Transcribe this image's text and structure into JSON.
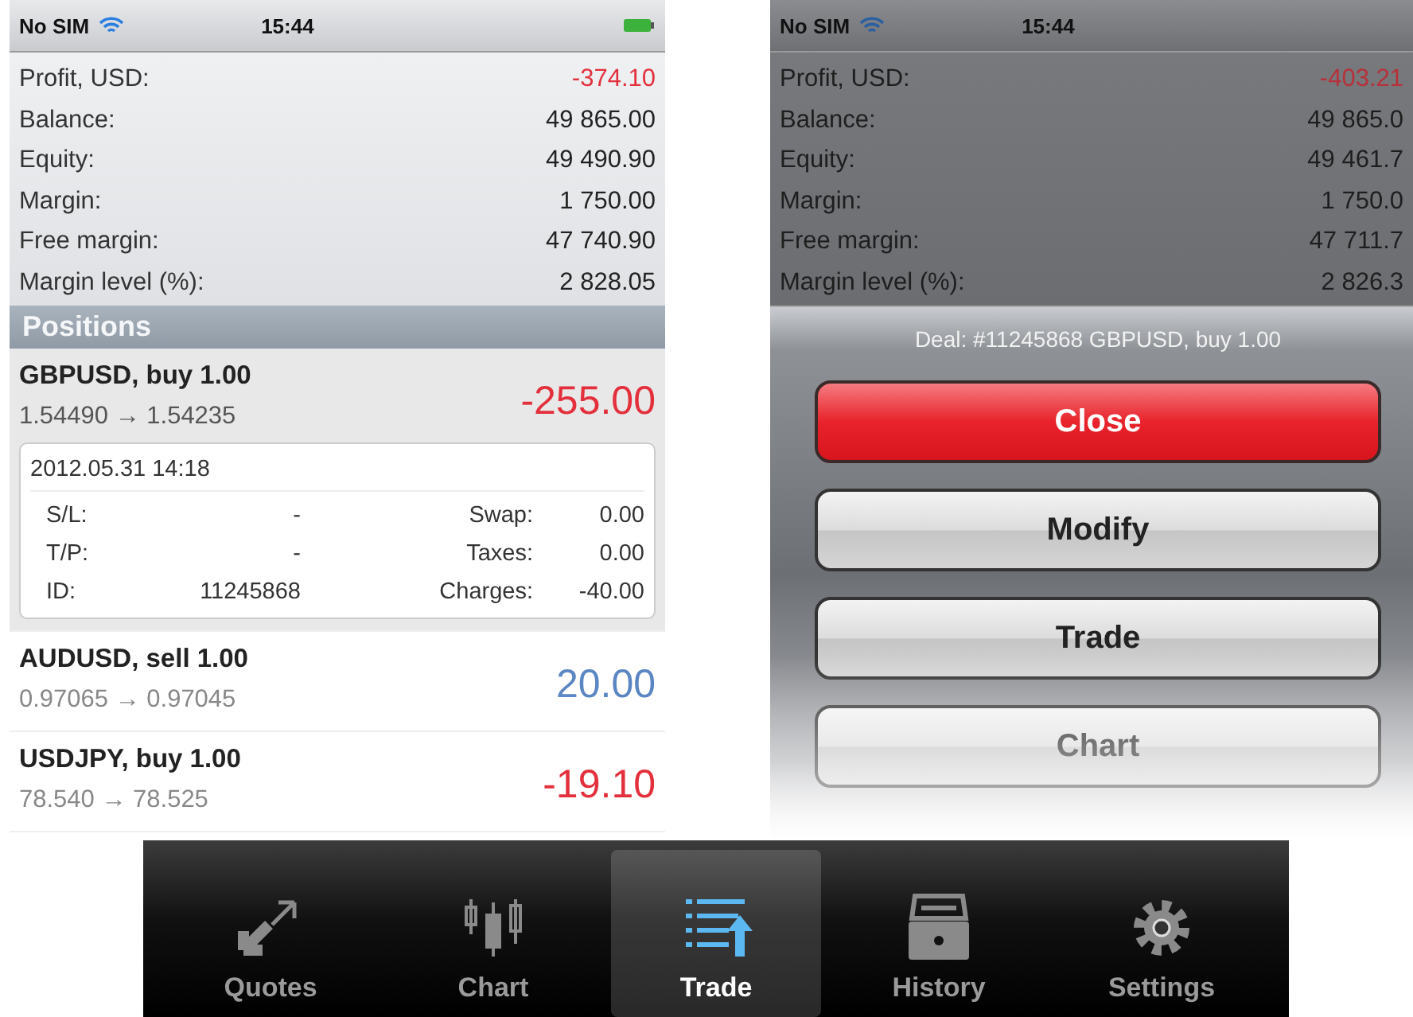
{
  "left_screen": {
    "status_bar": {
      "carrier": "No SIM",
      "time": "15:44"
    },
    "summary": [
      {
        "label": "Profit, USD:",
        "value": "-374.10",
        "color": "#e3303c"
      },
      {
        "label": "Balance:",
        "value": "49 865.00",
        "color": "#222222"
      },
      {
        "label": "Equity:",
        "value": "49 490.90",
        "color": "#222222"
      },
      {
        "label": "Margin:",
        "value": "1 750.00",
        "color": "#222222"
      },
      {
        "label": "Free margin:",
        "value": "47 740.90",
        "color": "#222222"
      },
      {
        "label": "Margin level (%):",
        "value": "2 828.05",
        "color": "#222222"
      }
    ],
    "section_title": "Positions",
    "positions": [
      {
        "title": "GBPUSD, buy 1.00",
        "prices": "1.54490 → 1.54235",
        "profit": "-255.00",
        "color": "#e3303c",
        "expanded": true,
        "details": {
          "time": "2012.05.31 14:18",
          "fields": [
            {
              "label": "S/L:",
              "value": "-"
            },
            {
              "label": "Swap:",
              "value": "0.00"
            },
            {
              "label": "T/P:",
              "value": "-"
            },
            {
              "label": "Taxes:",
              "value": "0.00"
            },
            {
              "label": "ID:",
              "value": "11245868"
            },
            {
              "label": "Charges:",
              "value": "-40.00"
            }
          ]
        }
      },
      {
        "title": "AUDUSD, sell 1.00",
        "prices": "0.97065 → 0.97045",
        "profit": "20.00",
        "color": "#5b86c4",
        "expanded": false
      },
      {
        "title": "USDJPY, buy 1.00",
        "prices": "78.540 → 78.525",
        "profit": "-19.10",
        "color": "#e3303c",
        "expanded": false
      }
    ]
  },
  "right_screen": {
    "status_bar": {
      "carrier": "No SIM",
      "time": "15:44"
    },
    "summary": [
      {
        "label": "Profit, USD:",
        "value": "-403.21",
        "color": "#b8303a"
      },
      {
        "label": "Balance:",
        "value": "49 865.0",
        "color": "#1e1e1e"
      },
      {
        "label": "Equity:",
        "value": "49 461.7",
        "color": "#1e1e1e"
      },
      {
        "label": "Margin:",
        "value": "1 750.0",
        "color": "#1e1e1e"
      },
      {
        "label": "Free margin:",
        "value": "47 711.7",
        "color": "#1e1e1e"
      },
      {
        "label": "Margin level (%):",
        "value": "2 826.3",
        "color": "#1e1e1e"
      }
    ],
    "action_sheet": {
      "title": "Deal: #11245868 GBPUSD, buy 1.00",
      "buttons": [
        {
          "label": "Close",
          "kind": "destructive"
        },
        {
          "label": "Modify",
          "kind": "default"
        },
        {
          "label": "Trade",
          "kind": "default"
        },
        {
          "label": "Chart",
          "kind": "default"
        }
      ]
    }
  },
  "tab_bar": {
    "tabs": [
      {
        "label": "Quotes",
        "selected": false
      },
      {
        "label": "Chart",
        "selected": false
      },
      {
        "label": "Trade",
        "selected": true
      },
      {
        "label": "History",
        "selected": false
      },
      {
        "label": "Settings",
        "selected": false
      }
    ]
  }
}
